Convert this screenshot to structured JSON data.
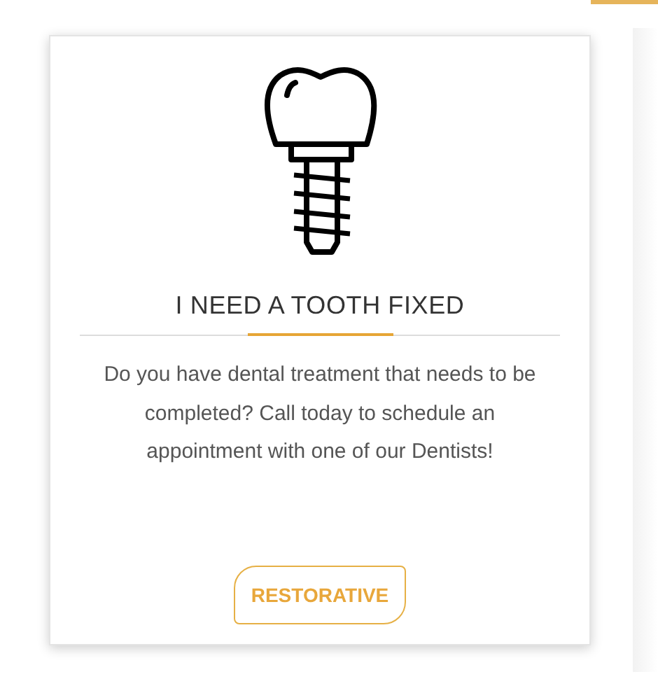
{
  "card": {
    "title": "I NEED A TOOTH FIXED",
    "description": "Do you have dental treatment that needs to be completed? Call today to schedule an appointment with one of our Dentists!",
    "button": "RESTORATIVE"
  }
}
